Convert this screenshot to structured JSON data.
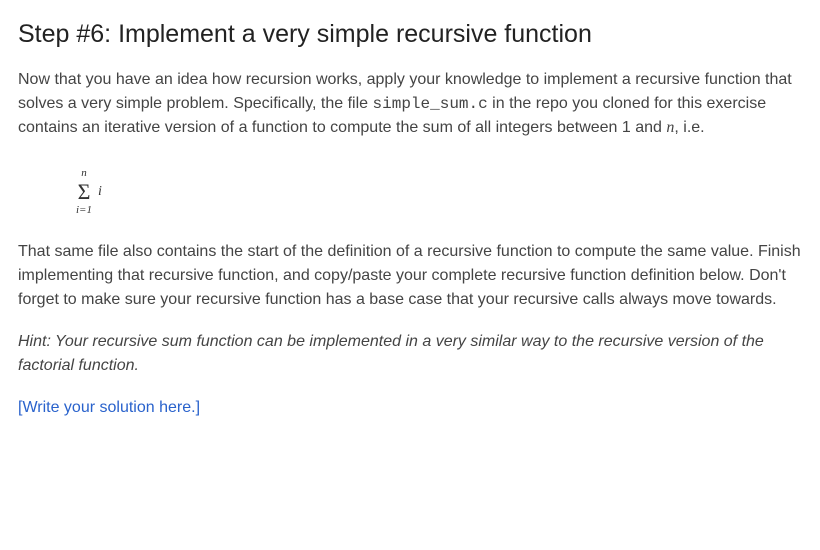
{
  "heading": "Step #6: Implement a very simple recursive function",
  "para1": {
    "part1": "Now that you have an idea how recursion works, apply your knowledge to implement a recursive function that solves a very simple problem.  Specifically, the file ",
    "code": "simple_sum.c",
    "part2": " in the repo you cloned for this exercise contains an iterative version of a function to compute the sum of all integers between 1 and ",
    "mathvar": "n",
    "part3": ", i.e."
  },
  "formula": {
    "upper": "n",
    "sigma": "Σ",
    "lower": "i=1",
    "body": "i"
  },
  "para2": "That same file also contains the start of the definition of a recursive function to compute the same value.  Finish implementing that recursive function, and copy/paste your complete recursive function definition below.  Don't forget to make sure your recursive function has a base case that your recursive calls always move towards.",
  "hint": "Hint: Your recursive sum function can be implemented in a very similar way to the recursive version of the factorial function.",
  "solution_placeholder": "[Write your solution here.]"
}
